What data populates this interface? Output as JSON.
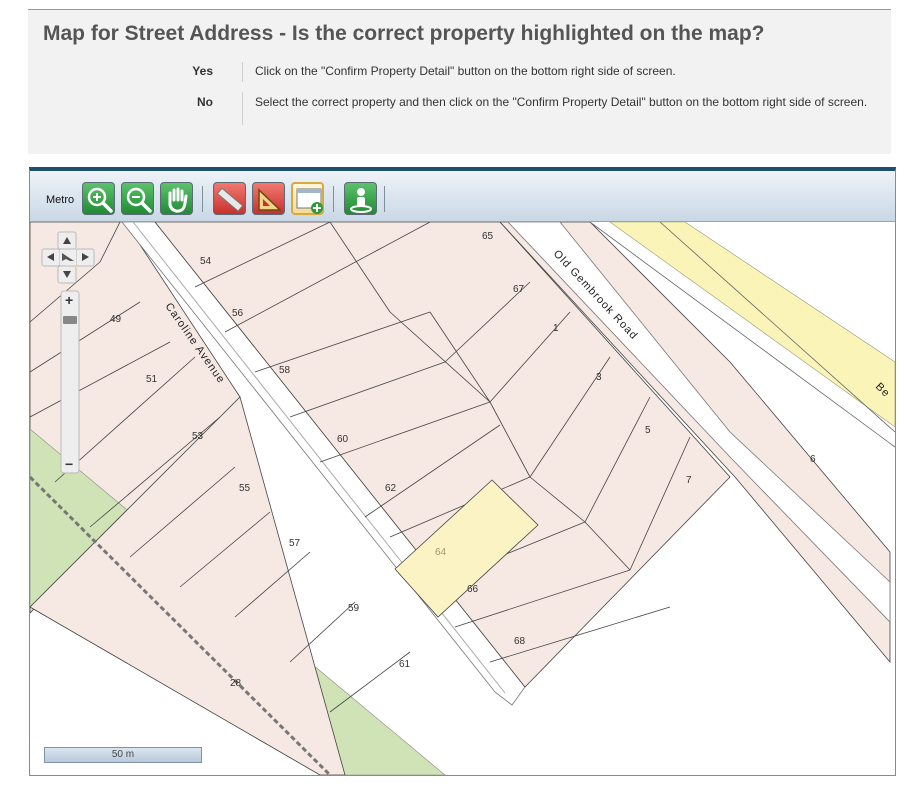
{
  "header": {
    "title": "Map for Street Address - Is the correct property highlighted on the map?",
    "options": [
      {
        "key": "Yes",
        "text": "Click on the \"Confirm Property Detail\" button on the bottom right side of screen."
      },
      {
        "key": "No",
        "text": "Select the correct property and then click on the \"Confirm Property Detail\" button on the bottom right side of screen."
      }
    ]
  },
  "toolbar": {
    "layer_label": "Metro",
    "tools": [
      {
        "name": "zoom-in-tool",
        "color": "green"
      },
      {
        "name": "zoom-out-tool",
        "color": "green"
      },
      {
        "name": "pan-tool",
        "color": "green"
      },
      {
        "name": "measure-distance-tool",
        "color": "red"
      },
      {
        "name": "measure-area-tool",
        "color": "red"
      },
      {
        "name": "add-window-tool",
        "color": "active"
      },
      {
        "name": "identify-tool",
        "color": "green"
      }
    ]
  },
  "map": {
    "streets": [
      "Caroline Avenue",
      "Old Gembrook Road",
      "Be"
    ],
    "lot_numbers": [
      "65",
      "54",
      "67",
      "49",
      "56",
      "1",
      "51",
      "58",
      "3",
      "53",
      "60",
      "5",
      "6",
      "7",
      "55",
      "62",
      "64",
      "57",
      "66",
      "59",
      "68",
      "61",
      "28"
    ],
    "highlighted_lot": "64",
    "scale_label": "50 m",
    "colors": {
      "parcel": "#f6e8e2",
      "highlight": "#fbf3c4",
      "road_reserve": "#faf4b8",
      "park": "#cfe3b6",
      "road": "#ffffff",
      "parcel_line": "#444444"
    }
  },
  "controls": {
    "pan_icons": [
      "pan-up-icon",
      "pan-left-icon",
      "pan-right-icon",
      "pan-down-icon"
    ],
    "zoom_plus": "+",
    "zoom_minus": "−"
  }
}
